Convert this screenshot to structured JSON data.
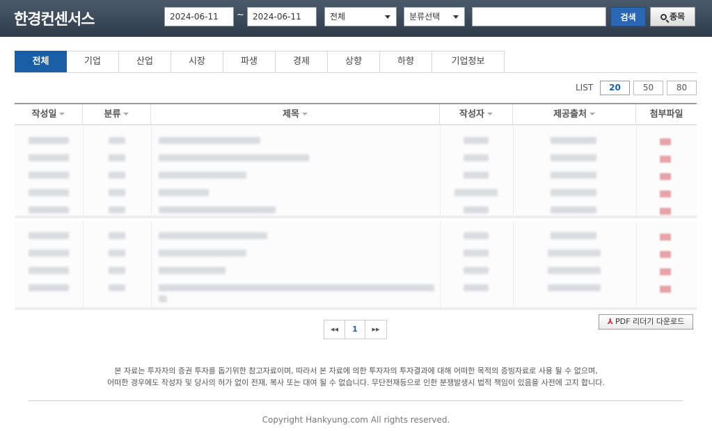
{
  "header": {
    "logo": "한경컨센서스",
    "date_from": "2024-06-11",
    "date_sep": "~",
    "date_to": "2024-06-11",
    "type_select": "전체",
    "category_select": "분류선택",
    "search_value": "",
    "search_button": "검색",
    "stock_button": "종목"
  },
  "tabs": [
    {
      "label": "전체",
      "active": true
    },
    {
      "label": "기업"
    },
    {
      "label": "산업"
    },
    {
      "label": "시장"
    },
    {
      "label": "파생"
    },
    {
      "label": "경제"
    },
    {
      "label": "상향"
    },
    {
      "label": "하향"
    },
    {
      "label": "기업정보"
    }
  ],
  "list_size": {
    "label": "LIST",
    "options": [
      "20",
      "50",
      "80"
    ],
    "selected": "20"
  },
  "table": {
    "columns": [
      "작성일",
      "분류",
      "제목",
      "작성자",
      "제공출처",
      "첨부파일"
    ]
  },
  "pagination": {
    "prev": "◂◂",
    "current": "1",
    "next": "▸▸"
  },
  "pdf_button": "PDF 리더기 다운로드",
  "notice": [
    "본 자료는 투자자의 증권 투자를 돕기위한 참고자료이며, 따라서 본 자료에 의한 투자자의 투자결과에 대해 어떠한 목적의 증빙자료로 사용 될 수 없으며,",
    "어떠한 경우에도 작성자 및 당사의 허가 없이 전재, 복사 또는 대여 될 수 없습니다. 무단전재등으로 인한 분쟁발생시 법적 책임이 있음을 사전에 고지 합니다."
  ],
  "copyright": "Copyright Hankyung.com All rights reserved.",
  "colors": {
    "header_bg": "#3a4756",
    "accent": "#1b5ea8",
    "search_btn": "#2a68b6"
  }
}
